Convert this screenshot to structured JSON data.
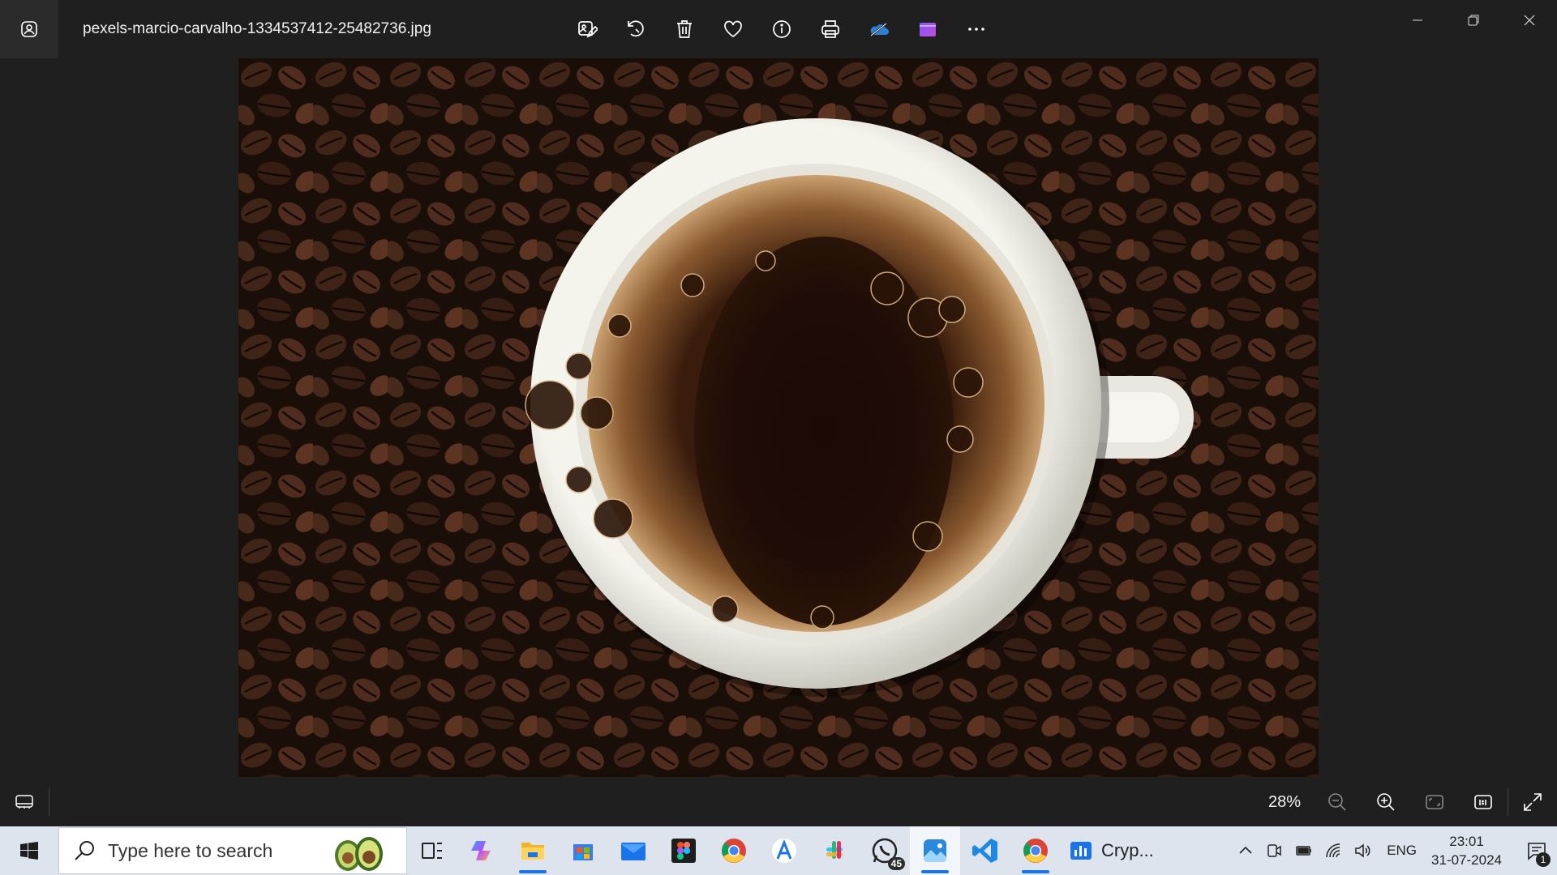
{
  "window": {
    "filename": "pexels-marcio-carvalho-1334537412-25482736.jpg",
    "app_icon": "photos-app-icon"
  },
  "toolbar": {
    "items": [
      "edit-image-icon",
      "rotate-icon",
      "delete-icon",
      "favorite-icon",
      "info-icon",
      "print-icon",
      "onedrive-icon",
      "clipchamp-icon",
      "more-icon"
    ]
  },
  "viewer": {
    "zoom_label": "28%"
  },
  "taskbar": {
    "search_placeholder": "Type here to search",
    "apps": [
      "task-view",
      "copilot",
      "file-explorer",
      "microsoft-store",
      "mail",
      "figma",
      "chrome",
      "app-a",
      "slack",
      "whatsapp",
      "photos",
      "vscode",
      "chrome-2"
    ],
    "whatsapp_badge": "45",
    "crypto_label": "Cryp...",
    "language": "ENG",
    "time": "23:01",
    "date": "31-07-2024",
    "notification_count": "1"
  },
  "colors": {
    "titlebar_bg": "#1f1f1f",
    "taskbar_bg": "#dde4ee",
    "accent": "#1a73e8"
  }
}
